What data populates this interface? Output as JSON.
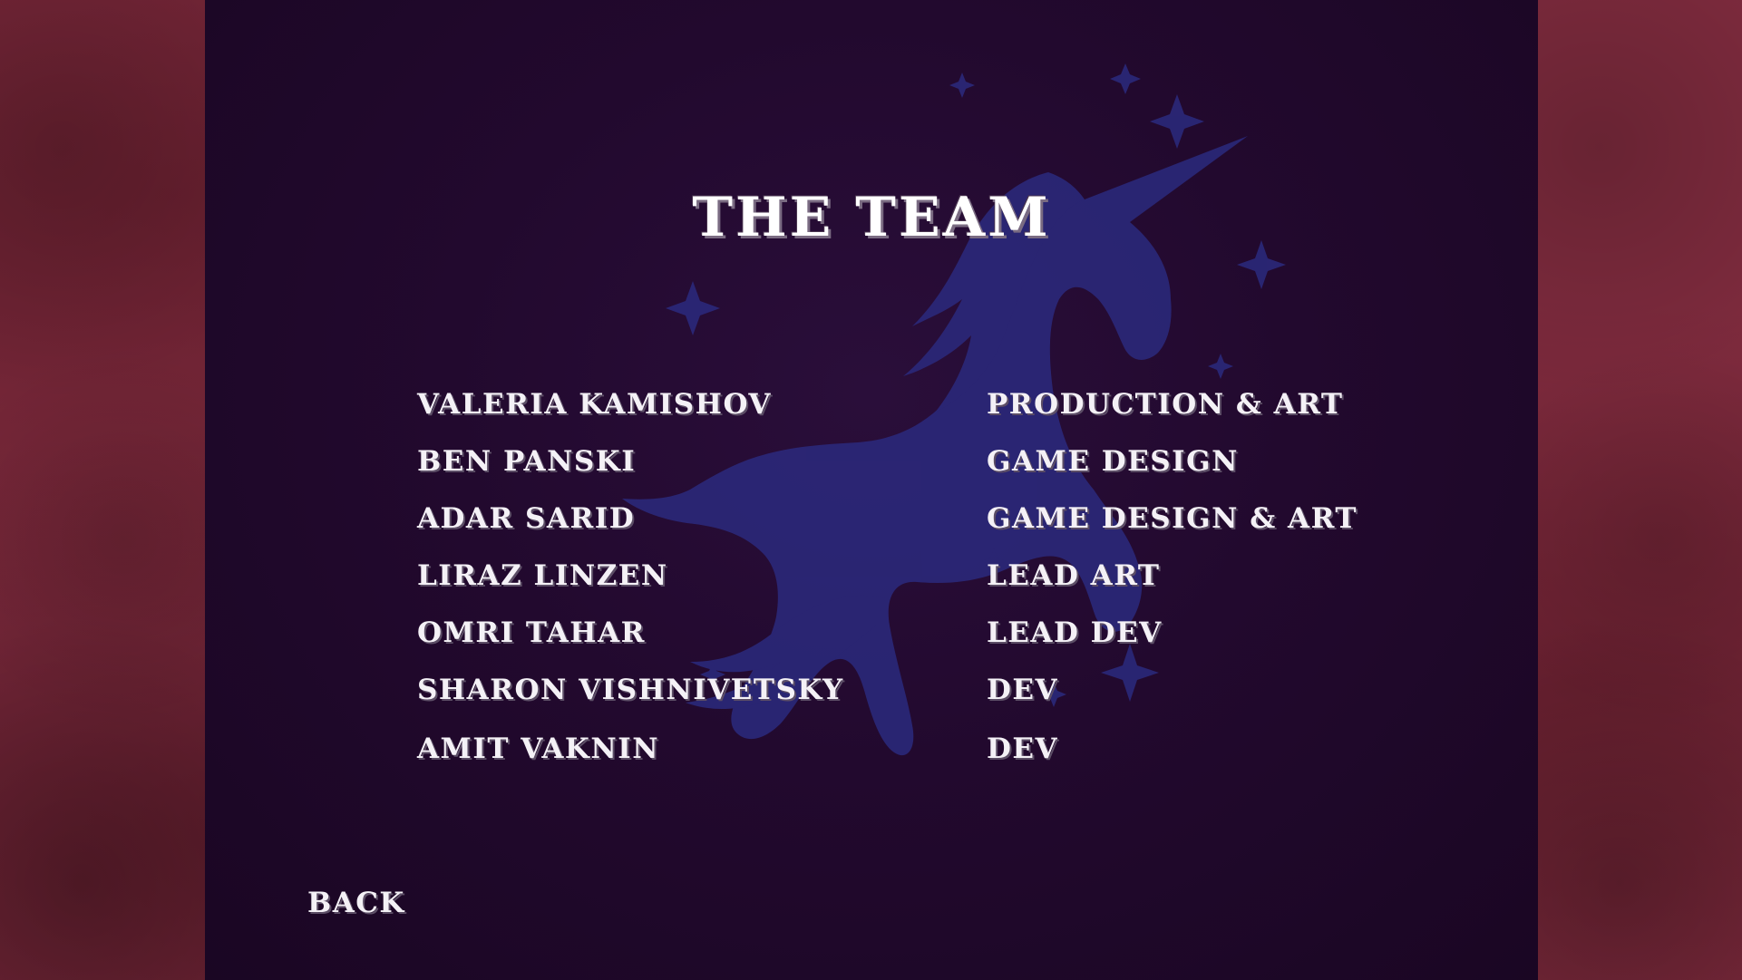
{
  "screen": {
    "title": "THE TEAM",
    "back_label": "BACK"
  },
  "team": [
    {
      "name": "VALERIA KAMISHOV",
      "role": "PRODUCTION & ART"
    },
    {
      "name": "BEN PANSKI",
      "role": "GAME DESIGN"
    },
    {
      "name": "ADAR SARID",
      "role": "GAME DESIGN & ART"
    },
    {
      "name": "LIRAZ LINZEN",
      "role": "LEAD ART"
    },
    {
      "name": "OMRI TAHAR",
      "role": "LEAD DEV"
    },
    {
      "name": "SHARON VISHNIVETSKY",
      "role": "DEV"
    },
    {
      "name": "AMIT VAKNIN",
      "role": "DEV"
    }
  ],
  "colors": {
    "side_background": "#7f2b3e",
    "panel_background": "#22092e",
    "unicorn_silhouette": "#2b2a7e",
    "text": "#f4f1f6"
  },
  "icons": {
    "background_art": "unicorn-silhouette-icon",
    "sparkles": "sparkle-icon"
  }
}
